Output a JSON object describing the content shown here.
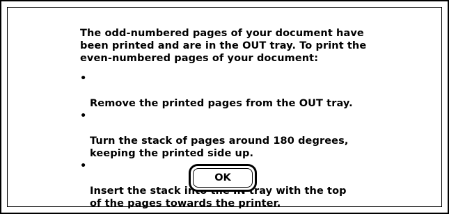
{
  "dialog": {
    "intro_lines": "The odd-numbered pages of your document have\nbeen printed and are in the OUT tray. To print the\neven-numbered pages of your document:",
    "bullet": "•",
    "steps": [
      "Remove the printed pages from the OUT tray.",
      "Turn the stack of pages around 180 degrees,\nkeeping the printed side up.",
      "Insert the stack into the IN tray with the top\nof the pages towards the printer."
    ],
    "ok_label": "OK"
  }
}
